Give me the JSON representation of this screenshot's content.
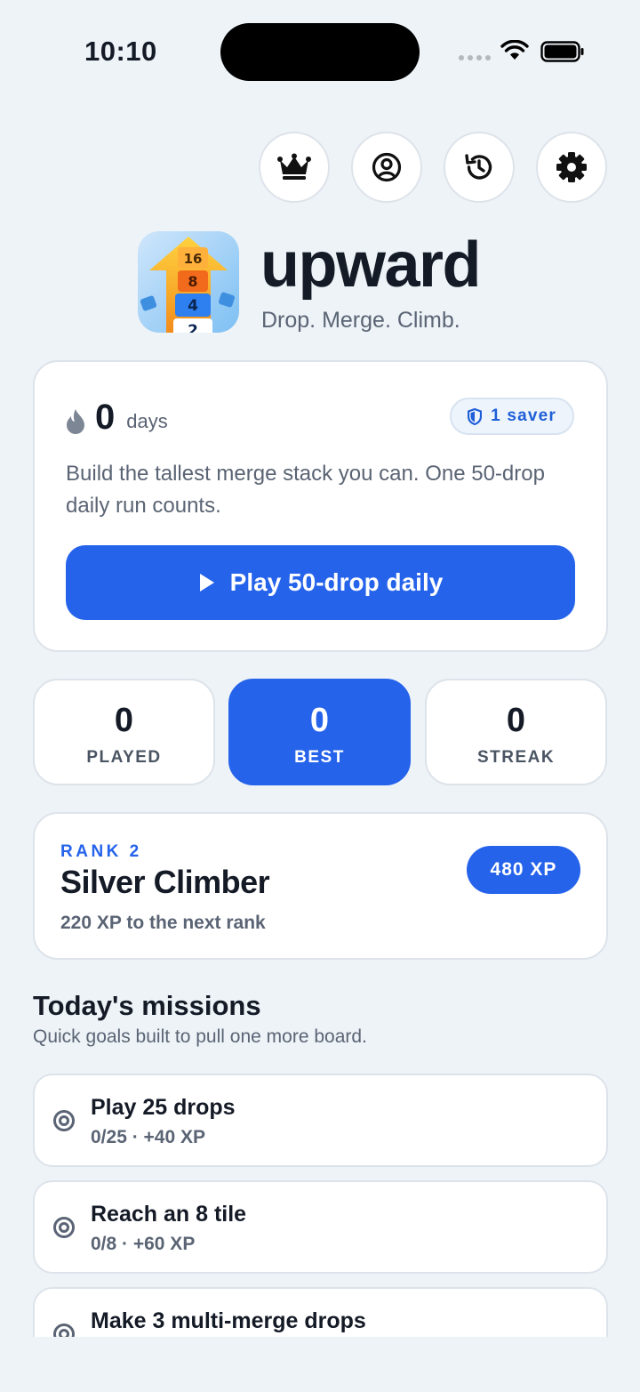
{
  "status_bar": {
    "time": "10:10"
  },
  "top_actions": [
    {
      "name": "leaderboard",
      "icon": "crown-icon"
    },
    {
      "name": "profile",
      "icon": "user-circle-icon"
    },
    {
      "name": "history",
      "icon": "history-icon"
    },
    {
      "name": "settings",
      "icon": "gear-icon"
    }
  ],
  "header": {
    "title": "upward",
    "tagline": "Drop. Merge. Climb.",
    "logo_tiles": [
      "16",
      "8",
      "4",
      "2"
    ]
  },
  "daily": {
    "streak_count": "0",
    "streak_unit": "days",
    "saver_label": "1 saver",
    "description": "Build the tallest merge stack you can. One 50-drop daily run counts.",
    "play_label": "Play 50-drop daily"
  },
  "stats": [
    {
      "value": "0",
      "label": "PLAYED",
      "active": false
    },
    {
      "value": "0",
      "label": "BEST",
      "active": true
    },
    {
      "value": "0",
      "label": "STREAK",
      "active": false
    }
  ],
  "rank": {
    "kicker": "RANK 2",
    "name": "Silver Climber",
    "next": "220 XP to the next rank",
    "xp": "480 XP"
  },
  "missions": {
    "title": "Today's missions",
    "subtitle": "Quick goals built to pull one more board.",
    "items": [
      {
        "title": "Play 25 drops",
        "meta": "0/25 · +40 XP"
      },
      {
        "title": "Reach an 8 tile",
        "meta": "0/8 · +60 XP"
      },
      {
        "title": "Make 3 multi-merge drops",
        "meta": ""
      }
    ]
  },
  "colors": {
    "accent": "#2563eb",
    "background": "#eef3f7",
    "card": "#ffffff",
    "text": "#141a26",
    "muted": "#5a6474"
  }
}
